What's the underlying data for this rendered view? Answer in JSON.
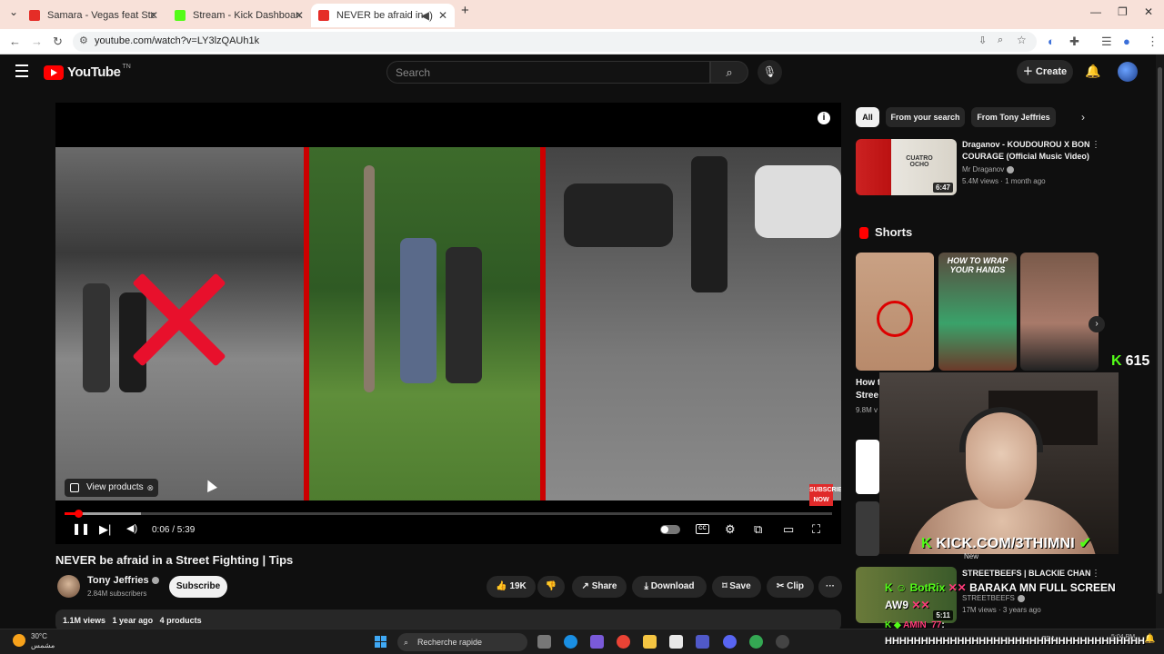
{
  "browser": {
    "tabs": [
      {
        "label": "Samara - Vegas feat Stou (Audi",
        "color": "#e52d27"
      },
      {
        "label": "Stream - Kick Dashboard",
        "color": "#53fc18"
      },
      {
        "label": "NEVER be afraid in a Street",
        "color": "#e52d27"
      }
    ],
    "new_tab": "+",
    "url": "youtube.com/watch?v=LY3lzQAUh1k"
  },
  "youtube": {
    "logo": "YouTube",
    "logo_sup": "TN",
    "search_placeholder": "Search",
    "create_label": "Create"
  },
  "player": {
    "view_products": "View products",
    "subscribe_badge": "SUBSCRIBE NOW",
    "time": "0:06 / 5:39",
    "played": 0.018,
    "loaded": 0.1
  },
  "video": {
    "title": "NEVER be afraid in a Street Fighting | Tips",
    "channel": "Tony Jeffries",
    "subscribers": "2.84M subscribers",
    "subscribe": "Subscribe",
    "likes": "19K",
    "share": "Share",
    "download": "Download",
    "save": "Save",
    "clip": "Clip",
    "views": "1.1M views",
    "age": "1 year ago",
    "products": "4 products"
  },
  "sidebar": {
    "chips": [
      "All",
      "From your search",
      "From Tony Jeffries"
    ],
    "rv1": {
      "title1": "Draganov - KOUDOUROU X BON",
      "title2": "COURAGE (Official Music Video)",
      "channel": "Mr Draganov",
      "meta": "5.4M views · 1 month ago",
      "duration": "6:47",
      "thumb_text": "CUATRO OCHO"
    },
    "shorts_title": "Shorts",
    "short2_caption": "HOW TO WRAP YOUR HANDS",
    "cut1": "How t",
    "cut2": "Stree",
    "cut3": "9.8M v",
    "rv3": {
      "title": "STREETBEEFS | BLACKIE CHAN",
      "channel": "STREETBEEFS",
      "meta": "17M views · 3 years ago",
      "duration": "5:11",
      "badge": "New"
    }
  },
  "stream": {
    "kick_count": "615",
    "kick_url": "KICK.COM/3THIMNI",
    "chat": [
      {
        "name": "BotRix",
        "msg": "BARAKA MN FULL SCREEN"
      },
      {
        "name": "AW9",
        "msg": ""
      },
      {
        "name": "AMIN_77",
        "msg": ":"
      },
      {
        "name": "",
        "msg": "HHHHHHHHHHHHHHHHHHHHHHHHHHHHHHHHHHHH"
      }
    ]
  },
  "taskbar": {
    "temperature": "30°C",
    "weather_text": "مشمس",
    "search": "Recherche rapide",
    "lang": "FRA",
    "time": "5:04 PM"
  }
}
